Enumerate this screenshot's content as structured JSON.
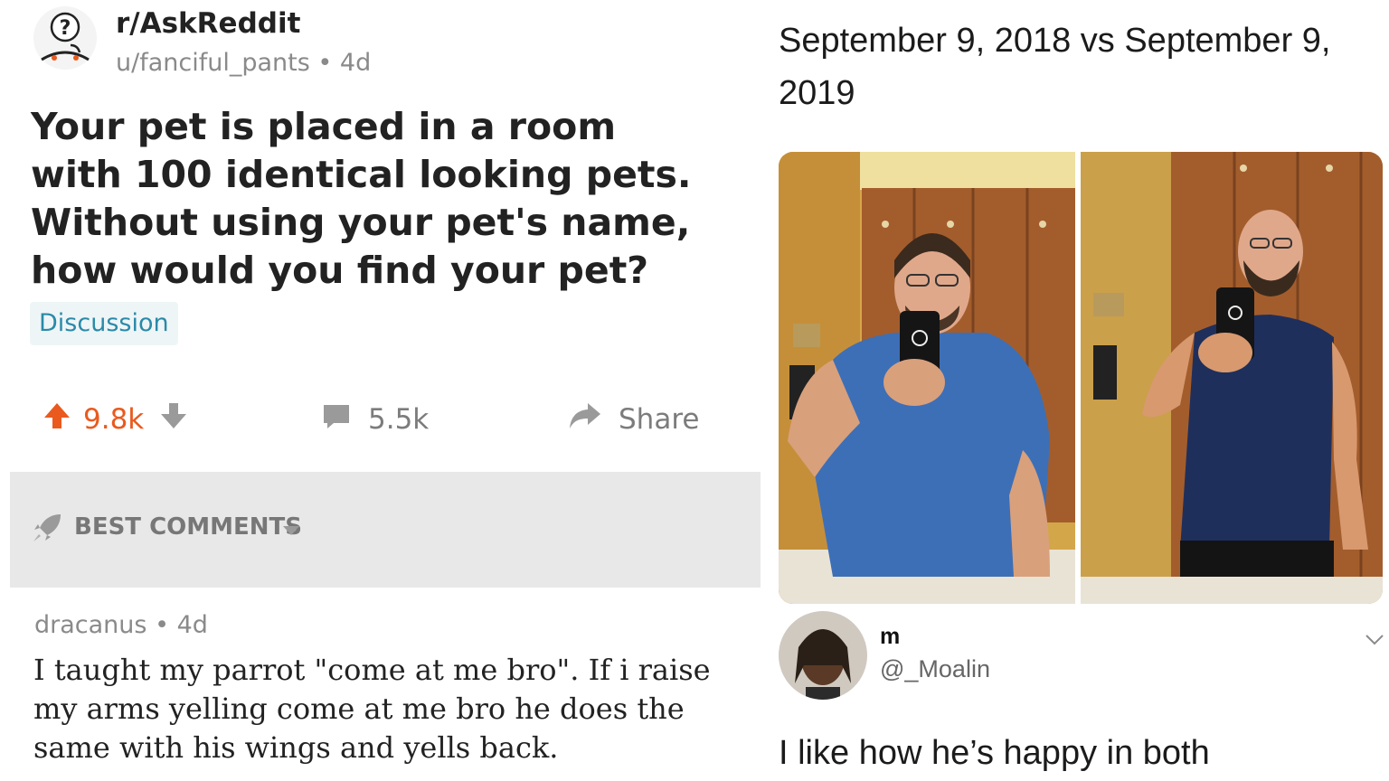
{
  "reddit": {
    "subreddit": "r/AskReddit",
    "author": "u/fanciful_pants",
    "age": "4d",
    "title": "Your pet is placed in a room with 100 identical looking pets. Without using your pet's name, how would you find your pet?",
    "flair": "Discussion",
    "upvotes": "9.8k",
    "comments": "5.5k",
    "share_label": "Share",
    "sort_label": "BEST COMMENTS",
    "comment": {
      "author": "dracanus",
      "age": "4d",
      "body": "I taught my parrot \"come at me bro\". If i raise my arms yelling come at me bro he does the same with his wings and yells back."
    }
  },
  "tweet": {
    "text": "September 9, 2018 vs September 9, 2019",
    "reply": {
      "name": "m",
      "handle": "@_Moalin",
      "text": "I like how he’s happy in both"
    }
  },
  "colors": {
    "upvote": "#ea5a1e",
    "flair_text": "#2a8aa8",
    "flair_bg": "#eef5f7",
    "meta_gray": "#8a8a8a",
    "sortbar_bg": "#e8e8e8"
  },
  "icons": [
    "askreddit-avatar-icon",
    "upvote-icon",
    "downvote-icon",
    "comment-icon",
    "share-icon",
    "rocket-icon",
    "caret-down-icon",
    "chevron-down-icon"
  ]
}
